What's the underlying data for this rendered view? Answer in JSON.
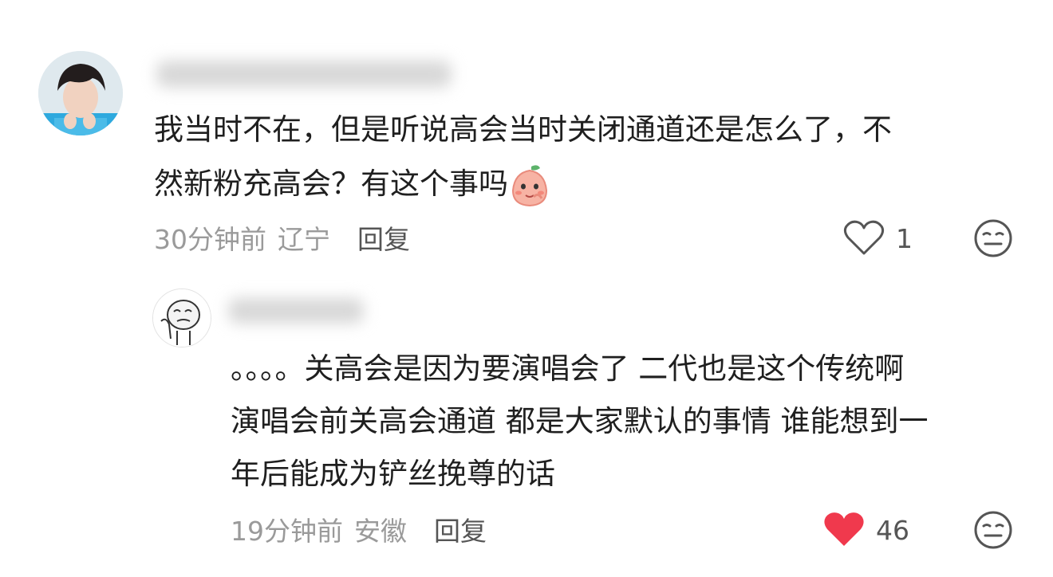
{
  "comments": [
    {
      "text_line1": "我当时不在，但是听说高会当时关闭通道还是怎么了，不",
      "text_line2": "然新粉充高会？有这个事吗",
      "emoji_icon": "peach-smirk-emoji",
      "time": "30分钟前",
      "location": "辽宁",
      "reply_label": "回复",
      "like_count": "1",
      "liked": false
    },
    {
      "text_line1": "。。。。关高会是因为要演唱会了 二代也是这个传统啊",
      "text_line2": "演唱会前关高会通道 都是大家默认的事情 谁能想到一",
      "text_line3": "年后能成为铲丝挽尊的话",
      "time": "19分钟前",
      "location": "安徽",
      "reply_label": "回复",
      "like_count": "46",
      "liked": true
    }
  ],
  "colors": {
    "liked_heart": "#f0394d",
    "text": "#1f1f1f",
    "meta": "#9a9a9a"
  }
}
